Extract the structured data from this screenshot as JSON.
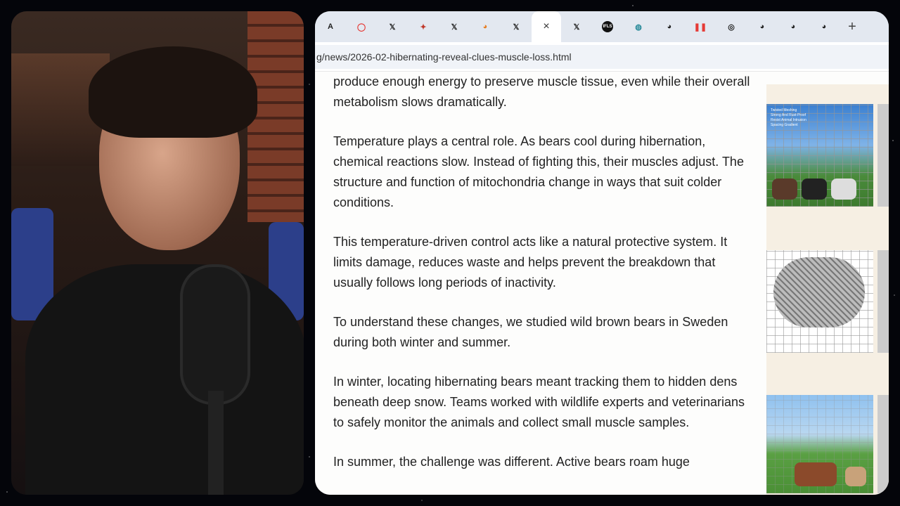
{
  "tabs": [
    {
      "icon": "generic-tab-icon",
      "glyph": "A"
    },
    {
      "icon": "chat-bubble-icon",
      "glyph": "◯",
      "color": "#e53935"
    },
    {
      "icon": "x-logo-icon",
      "glyph": "𝕏"
    },
    {
      "icon": "colorful-logo-icon",
      "glyph": "✦",
      "color": "#c0392b"
    },
    {
      "icon": "x-logo-icon",
      "glyph": "𝕏"
    },
    {
      "icon": "colorful-logo-icon",
      "glyph": "◕",
      "color": "#e67e22"
    },
    {
      "icon": "x-logo-icon",
      "glyph": "𝕏"
    },
    {
      "icon": "close-icon",
      "glyph": "×",
      "active": true
    },
    {
      "icon": "x-logo-icon",
      "glyph": "𝕏"
    },
    {
      "icon": "ifls-logo-icon",
      "glyph": "IFLS"
    },
    {
      "icon": "wikimedia-icon",
      "glyph": "◍",
      "color": "#2a8b9a"
    },
    {
      "icon": "globe-icon",
      "glyph": "◕"
    },
    {
      "icon": "pause-bars-icon",
      "glyph": "❚❚",
      "color": "#e53935"
    },
    {
      "icon": "circle-icon",
      "glyph": "◎"
    },
    {
      "icon": "globe-icon",
      "glyph": "◕"
    },
    {
      "icon": "globe-icon",
      "glyph": "◕"
    },
    {
      "icon": "globe-icon",
      "glyph": "◕"
    }
  ],
  "new_tab_label": "+",
  "address_bar": {
    "url": "g/news/2026-02-hibernating-reveal-clues-muscle-loss.html"
  },
  "article": {
    "paragraphs": [
      "produce enough energy to preserve muscle tissue, even while their overall metabolism slows dramatically.",
      "Temperature plays a central role. As bears cool during hibernation, chemical reactions slow. Instead of fighting this, their muscles adjust. The structure and function of mitochondria change in ways that suit colder conditions.",
      "This temperature-driven control acts like a natural protective system. It limits damage, reduces waste and helps prevent the breakdown that usually follows long periods of inactivity.",
      "To understand these changes, we studied wild brown bears in Sweden during both winter and summer.",
      "In winter, locating hibernating bears meant tracking them to hidden dens beneath deep snow. Teams worked with wildlife experts and veterinarians to safely monitor the animals and collect small muscle samples.",
      "In summer, the challenge was different. Active bears roam huge"
    ]
  },
  "ads": {
    "ad1_text": "Twisted Meshing\nStrong And Rust-Proof\nResist Animal Intrusion\nSpacing Gradient"
  }
}
